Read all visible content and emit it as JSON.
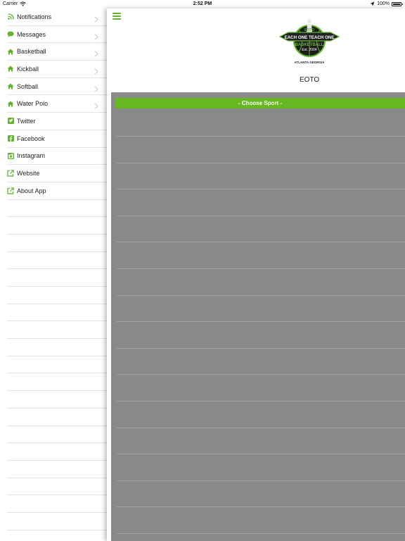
{
  "status_bar": {
    "carrier": "Carrier",
    "time": "2:52 PM",
    "battery": "100%",
    "battery_level": 1.0
  },
  "sidebar": {
    "items": [
      {
        "label": "Notifications",
        "icon": "rss-icon",
        "chevron": true
      },
      {
        "label": "Messages",
        "icon": "chat-bubble-icon",
        "chevron": true
      },
      {
        "label": "Basketball",
        "icon": "home-icon",
        "chevron": true
      },
      {
        "label": "Kickball",
        "icon": "home-icon",
        "chevron": true
      },
      {
        "label": "Softball",
        "icon": "home-icon",
        "chevron": true
      },
      {
        "label": "Water Polo",
        "icon": "home-icon",
        "chevron": true
      },
      {
        "label": "Twitter",
        "icon": "twitter-icon",
        "chevron": false
      },
      {
        "label": "Facebook",
        "icon": "facebook-icon",
        "chevron": false
      },
      {
        "label": "Instagram",
        "icon": "instagram-icon",
        "chevron": false
      },
      {
        "label": "Website",
        "icon": "external-link-icon",
        "chevron": false
      },
      {
        "label": "About App",
        "icon": "external-link-icon",
        "chevron": false
      }
    ]
  },
  "main": {
    "title": "EOTO",
    "choose_sport": "- Choose Sport -",
    "logo": {
      "top_text": "EOTO",
      "main_text": "EACH ONE TEACH ONE",
      "sub_text": "BASKETBALL",
      "est": "Est. 2004",
      "location": "ATLANTA GEORGIA"
    }
  },
  "colors": {
    "accent": "#66b821",
    "icon_green": "#5fb42c",
    "panel_grey": "#8a8a8a",
    "divider": "#e2e2e2"
  }
}
